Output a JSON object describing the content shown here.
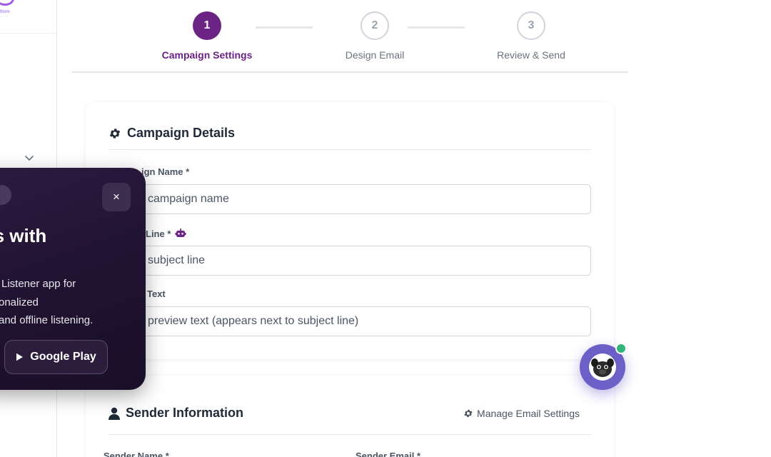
{
  "sidebar": {
    "logo_sub": "tform"
  },
  "stepper": {
    "steps": [
      {
        "number": "1",
        "label": "Campaign Settings"
      },
      {
        "number": "2",
        "label": "Design Email"
      },
      {
        "number": "3",
        "label": "Review & Send"
      }
    ]
  },
  "campaign_details": {
    "title": "Campaign Details",
    "name_label": "ign Name *",
    "name_placeholder": "campaign name",
    "subject_label": "Line *",
    "subject_placeholder": "subject line",
    "preview_label": "Text",
    "preview_placeholder": "preview text (appears next to subject line)"
  },
  "sender_info": {
    "title": "Sender Information",
    "manage_link": "Manage Email Settings",
    "name_label": "Sender Name *",
    "email_label": "Sender Email *"
  },
  "popup": {
    "close_label": "×",
    "headline": "asts with",
    "desc_lines": [
      "Listener app for",
      "onalized",
      "and offline listening."
    ],
    "store_button": "Google Play"
  },
  "colors": {
    "accent": "#6b2384",
    "chat": "#6c5fc7",
    "online": "#34b37a"
  }
}
